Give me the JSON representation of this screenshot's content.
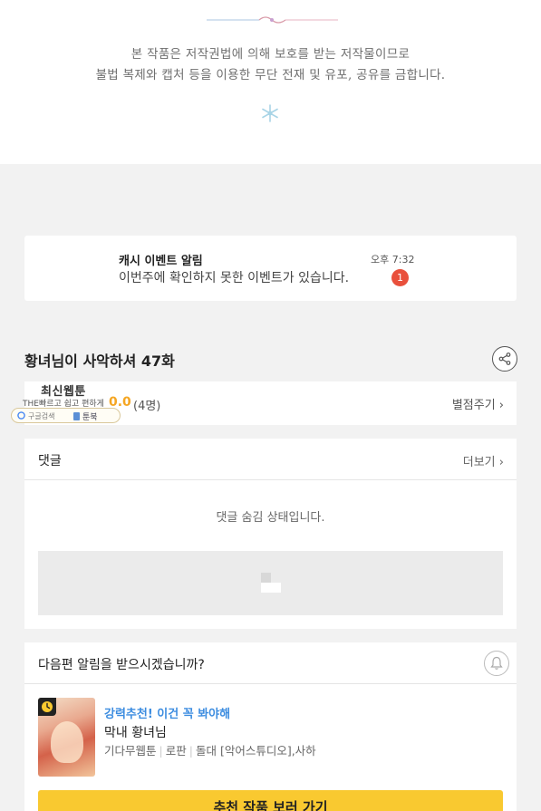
{
  "copyright": {
    "line1": "본 작품은 저작권법에 의해 보호를 받는 저작물이므로",
    "line2": "불법 복제와 캡처 등을 이용한 무단 전재 및 유포, 공유를 금합니다."
  },
  "notification": {
    "title": "캐시 이벤트 알림",
    "message": "이번주에 확인하지 못한 이벤트가 있습니다.",
    "time": "오후 7:32",
    "badge_count": "1"
  },
  "episode": {
    "title": "황녀님이 사악하셔 47화"
  },
  "rating": {
    "value": "0.0",
    "count": "(4명)",
    "rate_label": "별점주기"
  },
  "overlay": {
    "title": "최신웹툰",
    "subtitle": "THE빠르고 쉽고 편하게",
    "pill_left": "구글검색",
    "pill_right": "툰북"
  },
  "comments": {
    "title": "댓글",
    "more_label": "더보기",
    "hidden_message": "댓글 숨김 상태입니다."
  },
  "subscribe": {
    "question": "다음편 알림을 받으시겠습니까?",
    "promo_tag": "강력추천! 이건 꼭 봐야해",
    "promo_title": "막내 황녀님",
    "meta": [
      "기다무웹툰",
      "로판",
      "돌대 [악어스튜디오],사하"
    ],
    "cta_label": "추천 작품 보러 가기"
  },
  "colors": {
    "accent_yellow": "#f9c930",
    "badge_red": "#e9503c",
    "promo_blue": "#3d8de0",
    "rating_orange": "#f5a623"
  }
}
